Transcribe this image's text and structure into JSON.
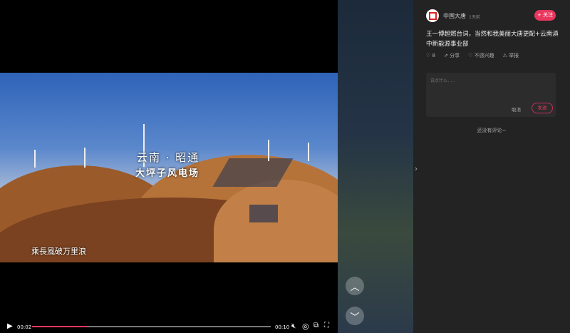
{
  "video": {
    "caption_place": "云南 · 昭通",
    "caption_site": "大坪子风电场",
    "caption_slogan": "乘長風破万里浪",
    "current_time": "00:02",
    "duration": "00:10",
    "progress": 0.23,
    "accent": "#e8365d"
  },
  "nav": {
    "prev_icon": "chevron-up-icon",
    "next_icon": "chevron-down-icon"
  },
  "post": {
    "author": "中国大唐",
    "time_ago": "1天前",
    "follow_label": "+ 关注",
    "text": "王一博超燃台词，当然和我美丽大唐更配+云南滇中新能源事业部",
    "likes": "8",
    "share_label": "分享",
    "not_interested_label": "不感兴趣",
    "report_label": "举报"
  },
  "comment": {
    "placeholder": "说点什么...",
    "cancel_label": "取消",
    "send_label": "发送",
    "empty_text": "还没有评论~"
  }
}
